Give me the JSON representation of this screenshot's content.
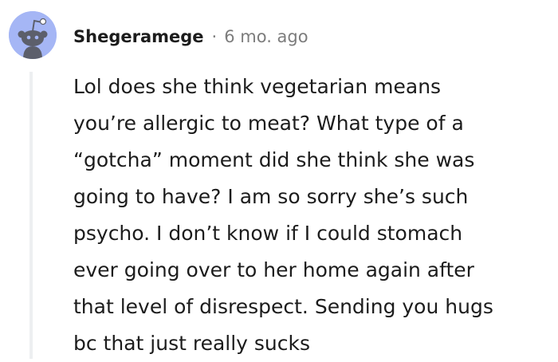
{
  "comment": {
    "author": "Shegeramege",
    "separator": "·",
    "timestamp": "6 mo. ago",
    "avatar_icon": "reddit-snoo-avatar-icon",
    "avatar_color": "#a5b6f5",
    "body_lines": [
      "Lol does she think vegetarian means",
      "you’re allergic to meat? What type of a",
      "“gotcha” moment did she think she was",
      "going to have? I am so sorry she’s such",
      "psycho. I don’t know if I could stomach",
      "ever going over to her home again after",
      "that level of disrespect. Sending you hugs",
      "bc that just really sucks"
    ]
  }
}
